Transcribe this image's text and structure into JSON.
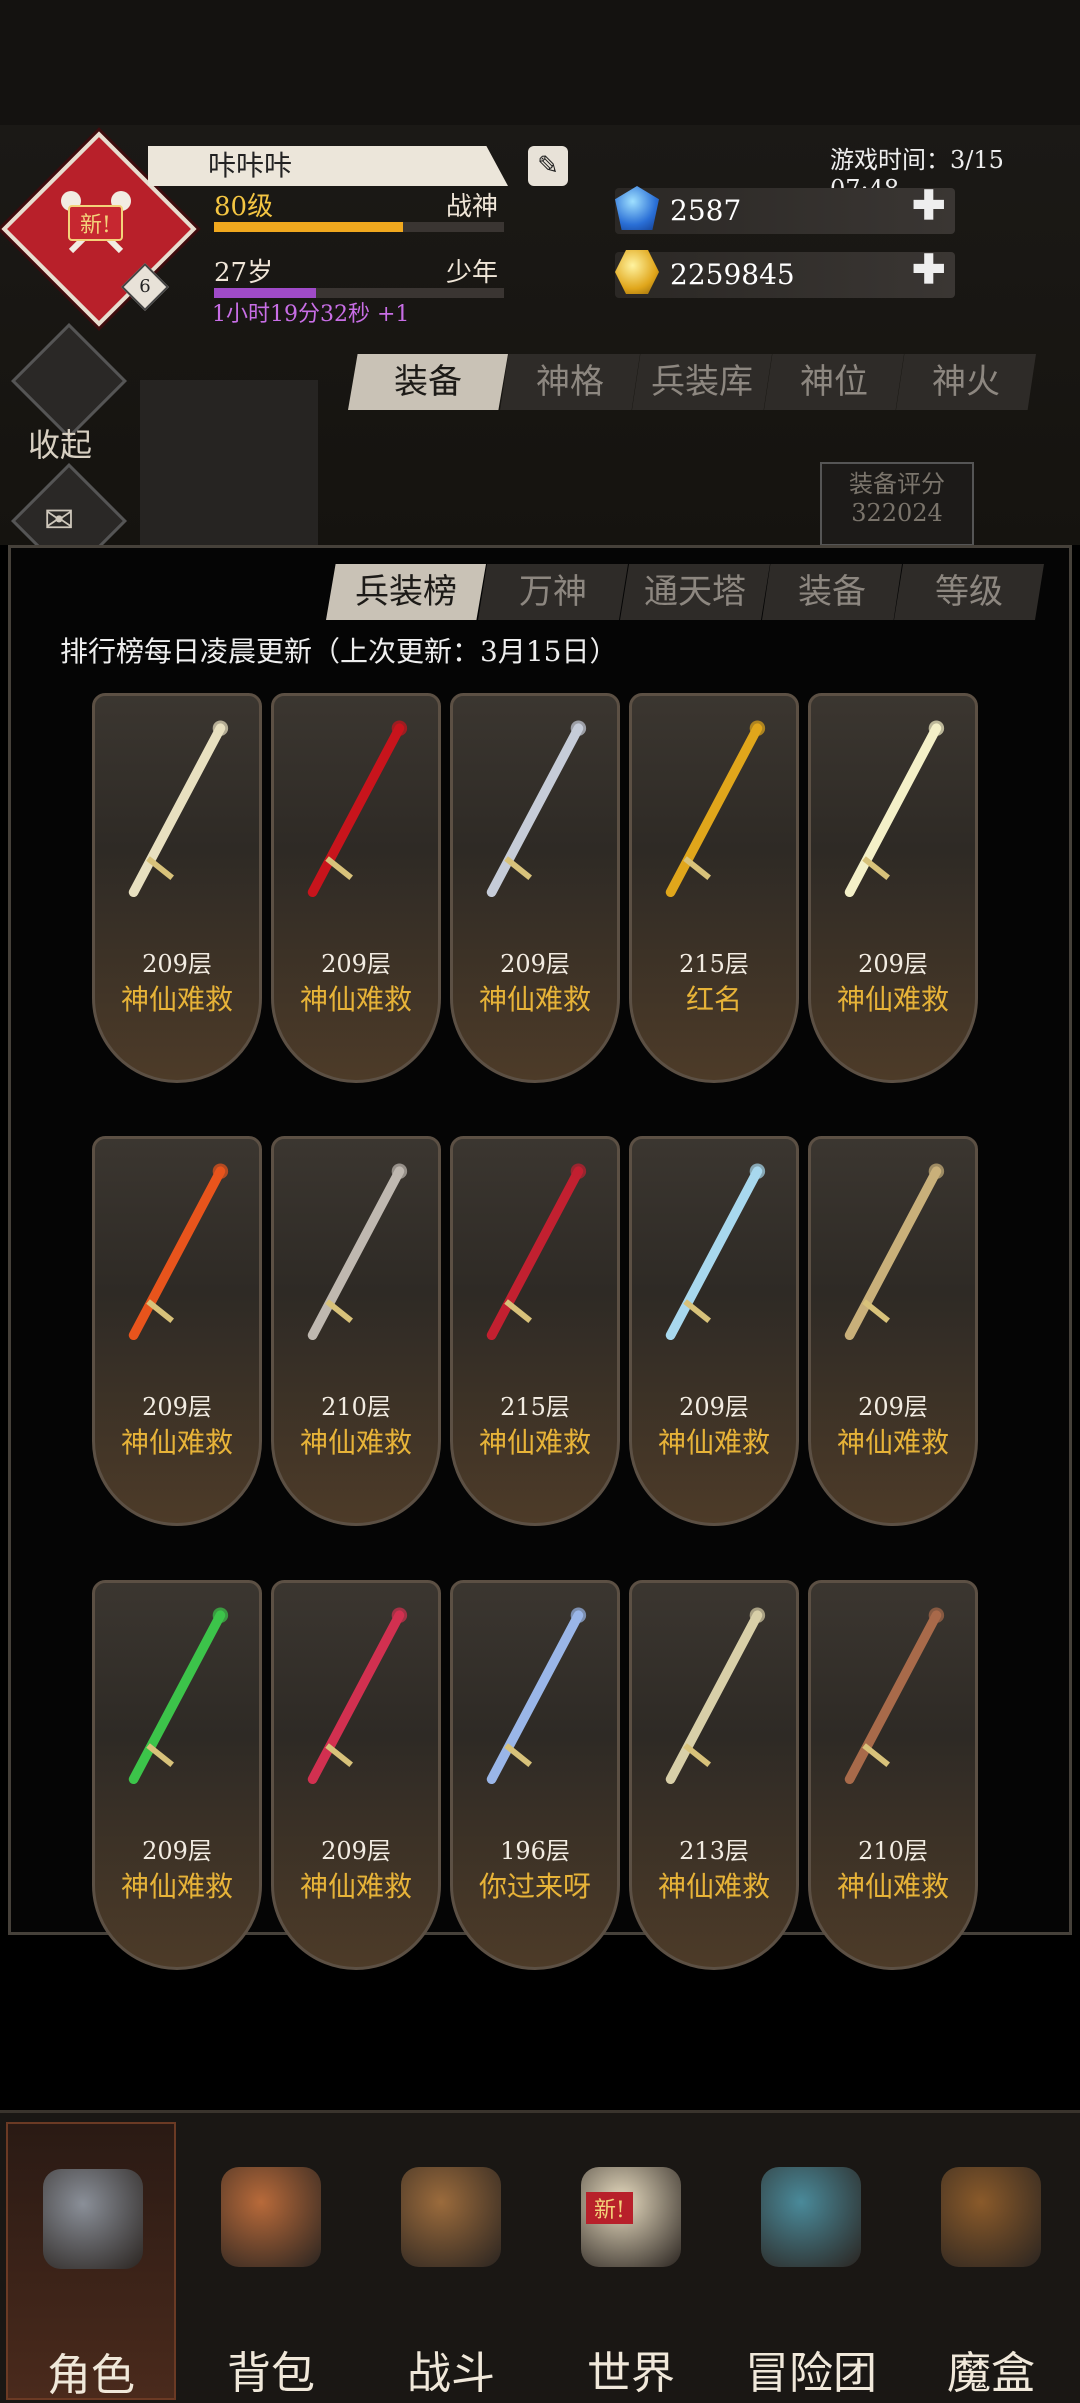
{
  "header": {
    "game_time": "游戏时间：3/15 07:48",
    "player_name": "咔咔咔",
    "avatar_badge": "新!",
    "avatar_level": "6",
    "level_text": "80级",
    "title_text": "战神",
    "age_text": "27岁",
    "age_stage": "少年",
    "timer_text": "1小时19分32秒 +1",
    "exp_progress": 0.65,
    "age_progress": 0.35,
    "diamonds": "2587",
    "gold": "2259845"
  },
  "side": {
    "collapse_label": "收起"
  },
  "top_tabs": [
    "装备",
    "神格",
    "兵装库",
    "神位",
    "神火"
  ],
  "score": {
    "label": "装备评分",
    "value": "322024"
  },
  "rank_tabs": [
    "兵装榜",
    "万神",
    "通天塔",
    "装备",
    "等级"
  ],
  "rank_note": "排行榜每日凌晨更新（上次更新：3月15日）",
  "cards": [
    {
      "floor": "209层",
      "player": "神仙难救",
      "weapon": "holy-sword-icon",
      "color": "#e8e0c0"
    },
    {
      "floor": "209层",
      "player": "神仙难救",
      "weapon": "crimson-blade-icon",
      "color": "#c8141c"
    },
    {
      "floor": "209层",
      "player": "神仙难救",
      "weapon": "katana-icon",
      "color": "#c6ccd8"
    },
    {
      "floor": "215层",
      "player": "红名",
      "weapon": "golden-staff-icon",
      "color": "#e0a61b"
    },
    {
      "floor": "209层",
      "player": "神仙难救",
      "weapon": "lightning-spear-icon",
      "color": "#f4f0c8"
    },
    {
      "floor": "209层",
      "player": "神仙难救",
      "weapon": "flame-scythe-icon",
      "color": "#e8541c"
    },
    {
      "floor": "210层",
      "player": "神仙难救",
      "weapon": "curved-dagger-icon",
      "color": "#bfb8b0"
    },
    {
      "floor": "215层",
      "player": "神仙难救",
      "weapon": "blood-sword-icon",
      "color": "#c22030"
    },
    {
      "floor": "209层",
      "player": "神仙难救",
      "weapon": "ice-axe-icon",
      "color": "#a8d8ee"
    },
    {
      "floor": "209层",
      "player": "神仙难救",
      "weapon": "horn-icon",
      "color": "#c9b07a"
    },
    {
      "floor": "209层",
      "player": "神仙难救",
      "weapon": "vine-staff-icon",
      "color": "#3cc44a"
    },
    {
      "floor": "209层",
      "player": "神仙难救",
      "weapon": "gem-flail-icon",
      "color": "#d23050"
    },
    {
      "floor": "196层",
      "player": "你过来呀",
      "weapon": "chain-gauntlet-icon",
      "color": "#9ab6e8"
    },
    {
      "floor": "213层",
      "player": "神仙难救",
      "weapon": "needle-spear-icon",
      "color": "#d8cfa8"
    },
    {
      "floor": "210层",
      "player": "神仙难救",
      "weapon": "flintlock-icon",
      "color": "#a86a4a"
    }
  ],
  "bottom_nav": [
    {
      "label": "角色",
      "icon": "helmet-icon",
      "active": true
    },
    {
      "label": "背包",
      "icon": "backpack-icon",
      "active": false
    },
    {
      "label": "战斗",
      "icon": "sword-shield-icon",
      "active": false
    },
    {
      "label": "世界",
      "icon": "scroll-icon",
      "active": false,
      "badge": "新!"
    },
    {
      "label": "冒险团",
      "icon": "castle-icon",
      "active": false
    },
    {
      "label": "魔盒",
      "icon": "magic-box-icon",
      "active": false
    }
  ]
}
